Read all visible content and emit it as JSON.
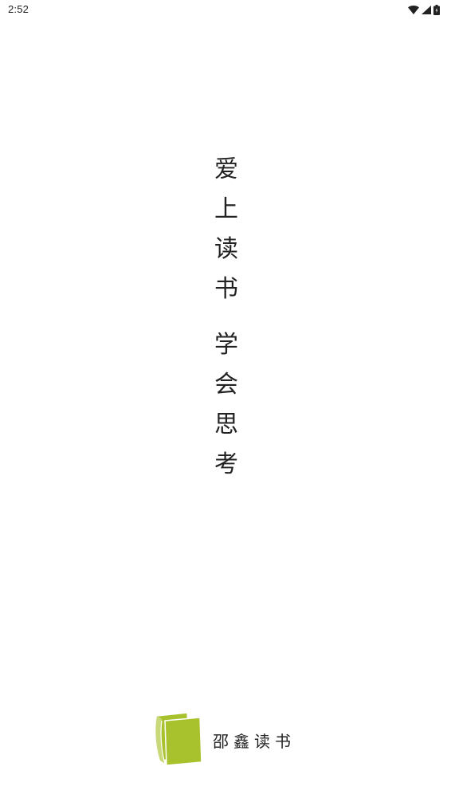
{
  "status_bar": {
    "time": "2:52",
    "icons": [
      "wifi-icon",
      "signal-icon",
      "battery-icon"
    ]
  },
  "slogan": {
    "line1": [
      "爱",
      "上",
      "读",
      "书"
    ],
    "line2": [
      "学",
      "会",
      "思",
      "考"
    ]
  },
  "brand": {
    "logo_icon": "book-icon",
    "name": "邵鑫读书",
    "logo_color": "#a8c22e"
  }
}
